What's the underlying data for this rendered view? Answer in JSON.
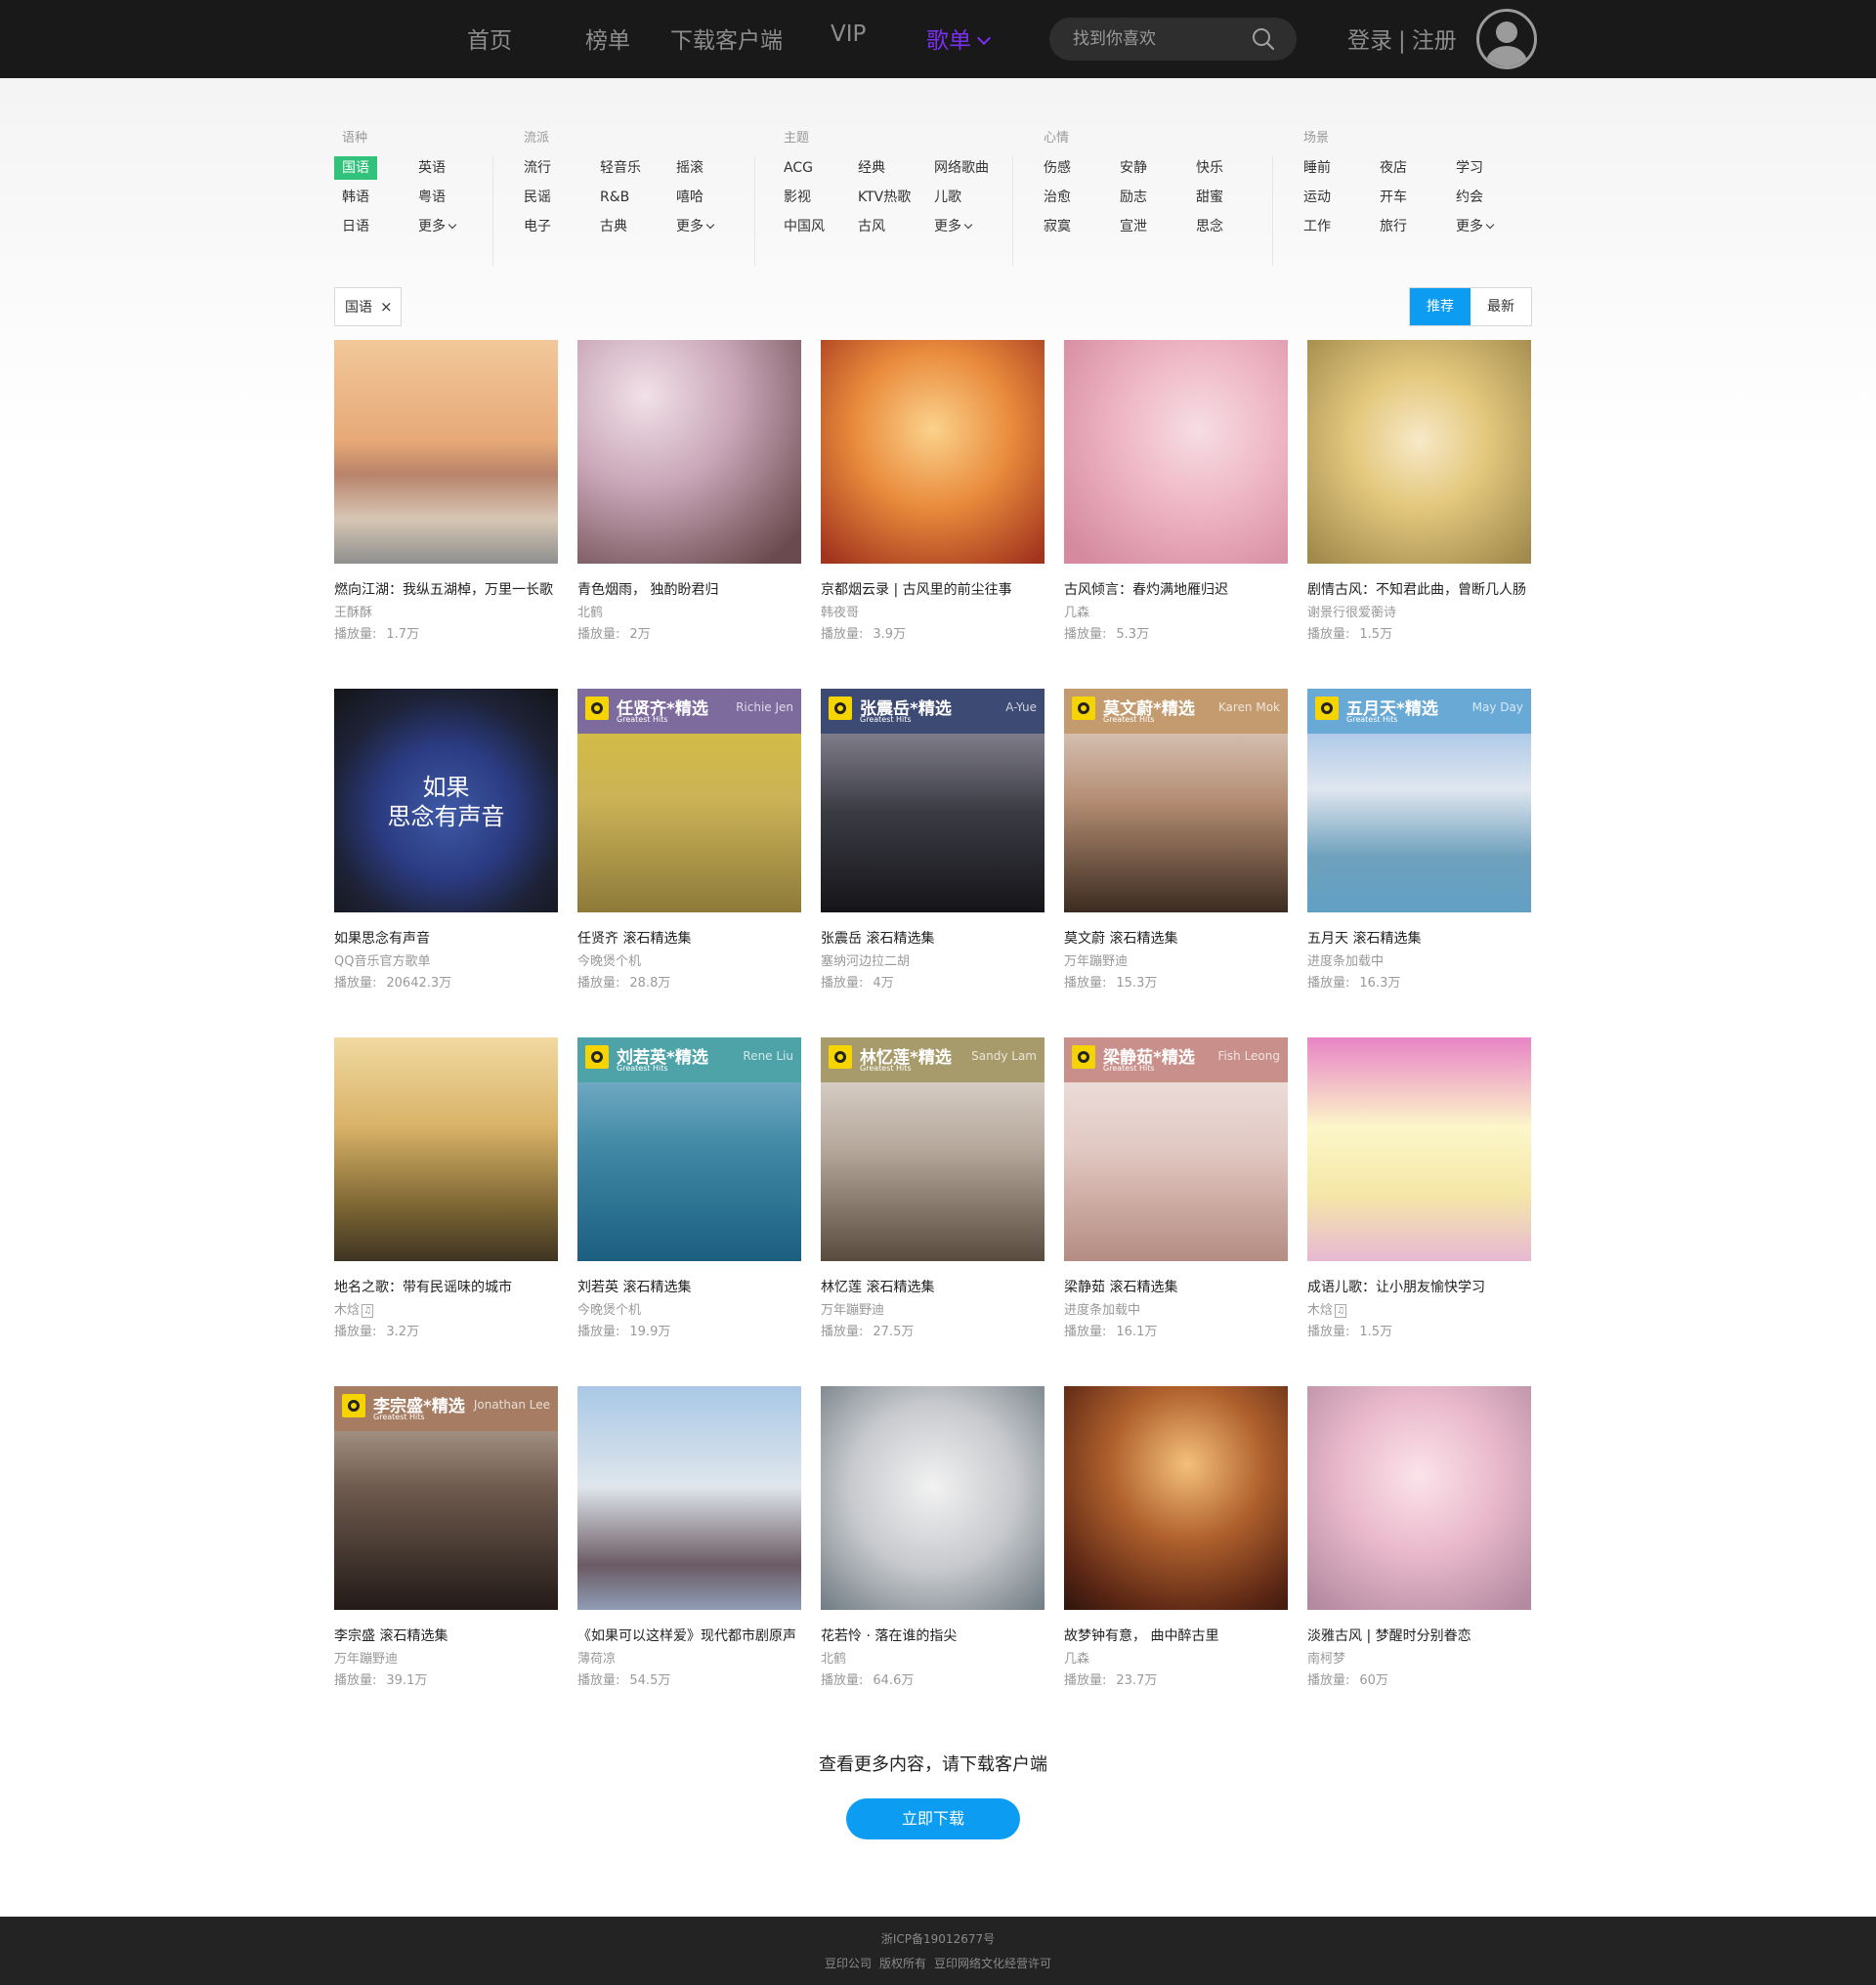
{
  "nav": {
    "items": [
      {
        "label": "首页",
        "active": false
      },
      {
        "label": "榜单",
        "active": false
      },
      {
        "label": "下载客户端",
        "active": false
      },
      {
        "label": "VIP",
        "active": false
      },
      {
        "label": "歌单",
        "active": true
      }
    ],
    "search_placeholder": "找到你喜欢",
    "login": "登录",
    "divider": "|",
    "register": "注册"
  },
  "categories": [
    {
      "title": "语种",
      "items": [
        "国语",
        "英语",
        "韩语",
        "粤语",
        "日语",
        "更多"
      ],
      "selected": "国语"
    },
    {
      "title": "流派",
      "items": [
        "流行",
        "轻音乐",
        "摇滚",
        "民谣",
        "R&B",
        "嘻哈",
        "电子",
        "古典",
        "更多"
      ]
    },
    {
      "title": "主题",
      "items": [
        "ACG",
        "经典",
        "网络歌曲",
        "影视",
        "KTV热歌",
        "儿歌",
        "中国风",
        "古风",
        "更多"
      ]
    },
    {
      "title": "心情",
      "items": [
        "伤感",
        "安静",
        "快乐",
        "治愈",
        "励志",
        "甜蜜",
        "寂寞",
        "宣泄",
        "思念"
      ]
    },
    {
      "title": "场景",
      "items": [
        "睡前",
        "夜店",
        "学习",
        "运动",
        "开车",
        "约会",
        "工作",
        "旅行",
        "更多"
      ]
    }
  ],
  "filter": {
    "active_tag": "国语",
    "close": "×",
    "sort_recommend": "推荐",
    "sort_latest": "最新"
  },
  "plays_label": "播放量:",
  "playlists": [
    {
      "title": "燃向江湖：我纵五湖棹，万里一长歌",
      "creator": "王酥酥",
      "plays": "1.7万",
      "cover": "desert"
    },
    {
      "title": "青色烟雨， 独酌盼君归",
      "creator": "北鹤",
      "plays": "2万",
      "cover": "rosy"
    },
    {
      "title": "京都烟云录 | 古风里的前尘往事",
      "creator": "韩夜哥",
      "plays": "3.9万",
      "cover": "orange"
    },
    {
      "title": "古风倾言：春灼满地雁归迟",
      "creator": "几森",
      "plays": "5.3万",
      "cover": "pink"
    },
    {
      "title": "剧情古风：不知君此曲，曾断几人肠",
      "creator": "谢景行很爱蘅诗",
      "plays": "1.5万",
      "cover": "golden"
    },
    {
      "title": "如果思念有声音",
      "creator": "QQ音乐官方歌单",
      "plays": "20642.3万",
      "cover": "night",
      "overlay": [
        "如果",
        "思念有声音"
      ]
    },
    {
      "title": "任贤齐 滚石精选集",
      "creator": "今晚煲个机",
      "plays": "28.8万",
      "cover": "rolling-purple",
      "banner": {
        "name": "任贤齐*精选",
        "sub": "Greatest Hits",
        "en": "Richie Jen"
      }
    },
    {
      "title": "张震岳 滚石精选集",
      "creator": "塞纳河边拉二胡",
      "plays": "4万",
      "cover": "rolling-navy",
      "banner": {
        "name": "张震岳*精选",
        "sub": "Greatest Hits",
        "en": "A-Yue"
      }
    },
    {
      "title": "莫文蔚 滚石精选集",
      "creator": "万年蹦野迪",
      "plays": "15.3万",
      "cover": "rolling-tan",
      "banner": {
        "name": "莫文蔚*精选",
        "sub": "Greatest Hits",
        "en": "Karen Mok"
      }
    },
    {
      "title": "五月天 滚石精选集",
      "creator": "进度条加载中",
      "plays": "16.3万",
      "cover": "rolling-blue",
      "banner": {
        "name": "五月天*精选",
        "sub": "Greatest Hits",
        "en": "May Day"
      }
    },
    {
      "title": "地名之歌：带有民谣味的城市",
      "creator": "木焓",
      "plays": "3.2万",
      "cover": "city",
      "vip": true
    },
    {
      "title": "刘若英 滚石精选集",
      "creator": "今晚煲个机",
      "plays": "19.9万",
      "cover": "rolling-teal",
      "banner": {
        "name": "刘若英*精选",
        "sub": "Greatest Hits",
        "en": "Rene Liu"
      }
    },
    {
      "title": "林忆莲 滚石精选集",
      "creator": "万年蹦野迪",
      "plays": "27.5万",
      "cover": "rolling-olive",
      "banner": {
        "name": "林忆莲*精选",
        "sub": "Greatest Hits",
        "en": "Sandy Lam"
      }
    },
    {
      "title": "梁静茹 滚石精选集",
      "creator": "进度条加载中",
      "plays": "16.1万",
      "cover": "rolling-rose",
      "banner": {
        "name": "梁静茹*精选",
        "sub": "Greatest Hits",
        "en": "Fish Leong"
      }
    },
    {
      "title": "成语儿歌：让小朋友愉快学习",
      "creator": "木焓",
      "plays": "1.5万",
      "cover": "cartoon",
      "vip": true
    },
    {
      "title": "李宗盛 滚石精选集",
      "creator": "万年蹦野迪",
      "plays": "39.1万",
      "cover": "rolling-brown",
      "banner": {
        "name": "李宗盛*精选",
        "sub": "Greatest Hits",
        "en": "Jonathan Lee"
      }
    },
    {
      "title": "《如果可以这样爱》现代都市剧原声",
      "creator": "薄荷凉",
      "plays": "54.5万",
      "cover": "sky"
    },
    {
      "title": "花若怜 · 落在谁的指尖",
      "creator": "北鹤",
      "plays": "64.6万",
      "cover": "snow"
    },
    {
      "title": "故梦钟有意， 曲中醉古里",
      "creator": "几森",
      "plays": "23.7万",
      "cover": "tea"
    },
    {
      "title": "淡雅古风 | 梦醒时分别眷恋",
      "creator": "南柯梦",
      "plays": "60万",
      "cover": "blossom"
    }
  ],
  "cta": {
    "text": "查看更多内容，请下载客户端",
    "button": "立即下载"
  },
  "footer": {
    "icp": "浙ICP备19012677号",
    "company": "豆印公司",
    "rights": "版权所有",
    "license": "豆印网络文化经营许可"
  },
  "colors": {
    "accent": "#7b2ff0",
    "selected_tag": "#31c27c",
    "primary": "#0c9df2",
    "topbar": "#191919"
  }
}
